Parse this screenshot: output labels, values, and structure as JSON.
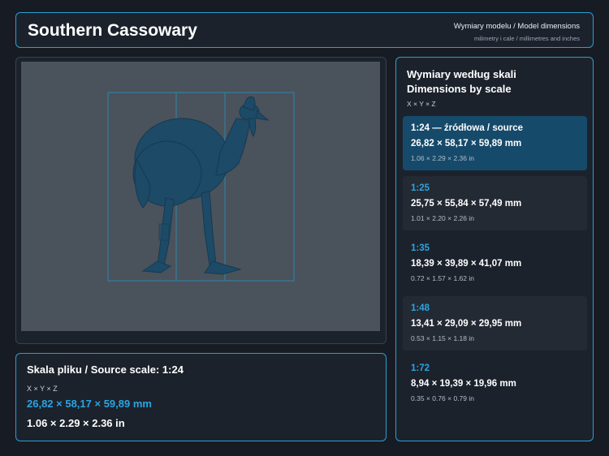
{
  "header": {
    "title": "Southern Cassowary",
    "subtitle": "Wymiary modelu / Model dimensions",
    "units_note": "milimetry i cale / millimetres and inches"
  },
  "source": {
    "title": "Skala pliku / Source scale: 1:24",
    "axes": "X × Y × Z",
    "mm": "26,82 × 58,17 × 59,89 mm",
    "in": "1.06 × 2.29 × 2.36 in"
  },
  "scales": {
    "title_pl": "Wymiary według skali",
    "title_en": "Dimensions by scale",
    "axes": "X × Y × Z",
    "items": [
      {
        "label": "1:24  —  źródłowa / source",
        "mm": "26,82 × 58,17 × 59,89 mm",
        "in": "1.06 × 2.29 × 2.36 in",
        "active": true
      },
      {
        "label": "1:25",
        "mm": "25,75 × 55,84 × 57,49 mm",
        "in": "1.01 × 2.20 × 2.26 in",
        "active": false
      },
      {
        "label": "1:35",
        "mm": "18,39 × 39,89 × 41,07 mm",
        "in": "0.72 × 1.57 × 1.62 in",
        "active": false
      },
      {
        "label": "1:48",
        "mm": "13,41 × 29,09 × 29,95 mm",
        "in": "0.53 × 1.15 × 1.18 in",
        "active": false
      },
      {
        "label": "1:72",
        "mm": "8,94 × 19,39 × 19,96 mm",
        "in": "0.35 × 0.76 × 0.79 in",
        "active": false
      }
    ]
  },
  "colors": {
    "accent": "#2ba4e0",
    "border": "#2a9fd0",
    "model": "#1d4a66",
    "background": "#171c24"
  },
  "viewer": {
    "model_icon": "cassowary-model-icon"
  }
}
